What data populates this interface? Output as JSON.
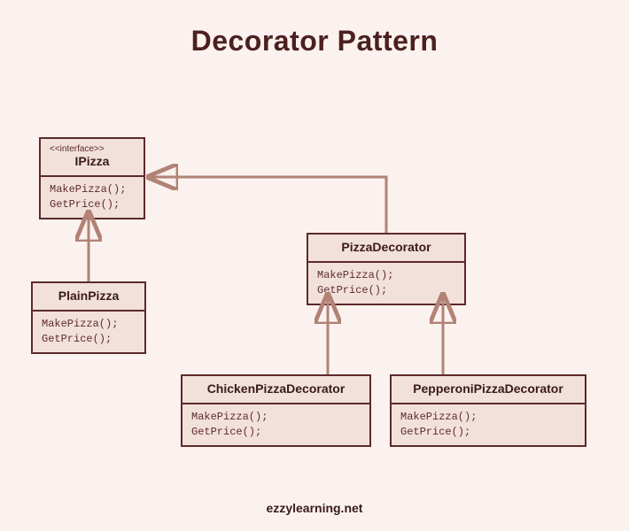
{
  "title": "Decorator Pattern",
  "footer": "ezzylearning.net",
  "boxes": {
    "ipizza": {
      "stereotype": "<<interface>>",
      "name": "IPizza",
      "method1": "MakePizza();",
      "method2": "GetPrice();"
    },
    "plainpizza": {
      "name": "PlainPizza",
      "method1": "MakePizza();",
      "method2": "GetPrice();"
    },
    "pizzadecorator": {
      "name": "PizzaDecorator",
      "method1": "MakePizza();",
      "method2": "GetPrice();"
    },
    "chicken": {
      "name": "ChickenPizzaDecorator",
      "method1": "MakePizza();",
      "method2": "GetPrice();"
    },
    "pepperoni": {
      "name": "PepperoniPizzaDecorator",
      "method1": "MakePizza();",
      "method2": "GetPrice();"
    }
  }
}
